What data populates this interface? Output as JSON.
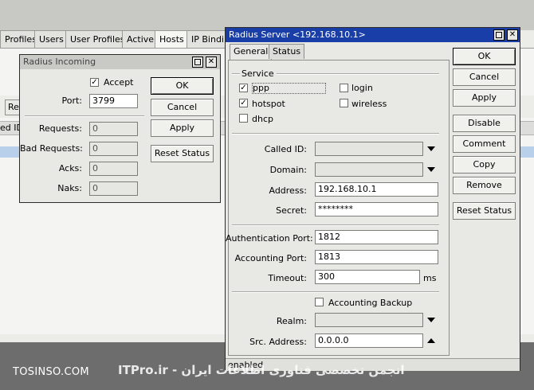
{
  "background": {
    "tabs": [
      "Profiles",
      "Users",
      "User Profiles",
      "Active",
      "Hosts",
      "IP Bindin"
    ],
    "active_tab": "Hosts",
    "toolbar_btn_fragment": "Re",
    "column_fragment": "ed ID"
  },
  "incoming": {
    "title": "Radius Incoming",
    "accept_label": "Accept",
    "accept_checked": true,
    "port_label": "Port:",
    "port_value": "3799",
    "requests_label": "Requests:",
    "requests_value": "0",
    "bad_requests_label": "Bad Requests:",
    "bad_requests_value": "0",
    "acks_label": "Acks:",
    "acks_value": "0",
    "naks_label": "Naks:",
    "naks_value": "0",
    "buttons": {
      "ok": "OK",
      "cancel": "Cancel",
      "apply": "Apply",
      "reset_status": "Reset Status"
    }
  },
  "server": {
    "title": "Radius Server <192.168.10.1>",
    "tabs": [
      "General",
      "Status"
    ],
    "service_label": "Service",
    "services": [
      {
        "label": "ppp",
        "checked": true
      },
      {
        "label": "login",
        "checked": false
      },
      {
        "label": "hotspot",
        "checked": true
      },
      {
        "label": "wireless",
        "checked": false
      },
      {
        "label": "dhcp",
        "checked": false
      }
    ],
    "called_id_label": "Called ID:",
    "called_id_value": "",
    "domain_label": "Domain:",
    "domain_value": "",
    "address_label": "Address:",
    "address_value": "192.168.10.1",
    "secret_label": "Secret:",
    "secret_value": "********",
    "auth_port_label": "Authentication Port:",
    "auth_port_value": "1812",
    "acct_port_label": "Accounting Port:",
    "acct_port_value": "1813",
    "timeout_label": "Timeout:",
    "timeout_value": "300",
    "timeout_unit": "ms",
    "accounting_backup_label": "Accounting Backup",
    "accounting_backup_checked": false,
    "realm_label": "Realm:",
    "realm_value": "",
    "src_address_label": "Src. Address:",
    "src_address_value": "0.0.0.0",
    "status": "enabled",
    "buttons": {
      "ok": "OK",
      "cancel": "Cancel",
      "apply": "Apply",
      "disable": "Disable",
      "comment": "Comment",
      "copy": "Copy",
      "remove": "Remove",
      "reset_status": "Reset Status"
    }
  },
  "watermark": {
    "left": "TOSINSO.COM",
    "right": "ITPro.ir - انجمن تخصصی فناوری اطلاعات ایران"
  },
  "colors": {
    "active_title": "#1a3ea8",
    "inactive_title": "#c9c9c5",
    "window_bg": "#e8e8e4"
  }
}
